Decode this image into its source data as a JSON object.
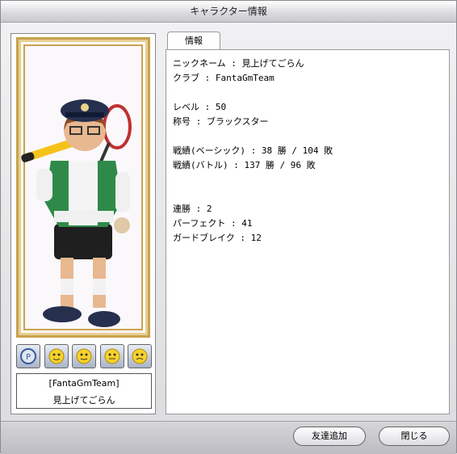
{
  "window": {
    "title": "キャラクター情報"
  },
  "character": {
    "team": "[FantaGmTeam]",
    "name": "見上げてごらん"
  },
  "emotes": [
    "pangya-logo-icon",
    "emote-face-icon",
    "emote-face-icon",
    "emote-face-icon",
    "emote-face-icon"
  ],
  "tabs": [
    {
      "label": "情報"
    }
  ],
  "info": {
    "nickname": "ニックネーム : 見上げてごらん",
    "club": "クラブ : FantaGmTeam",
    "level": "レベル : 50",
    "title": "称号 : ブラックスター",
    "record_basic": "戦績(ベーシック) : 38 勝 / 104 敗",
    "record_battle": "戦績(バトル) : 137 勝 / 96 敗",
    "win_streak": "連勝 : 2",
    "perfect": "パーフェクト : 41",
    "guard_break": "ガードブレイク : 12"
  },
  "buttons": {
    "add_friend": "友達追加",
    "close": "閉じる"
  },
  "colors": {
    "frame_gold": "#c8a24e",
    "jacket_green": "#2f8a4a",
    "cap_navy": "#25304f"
  }
}
